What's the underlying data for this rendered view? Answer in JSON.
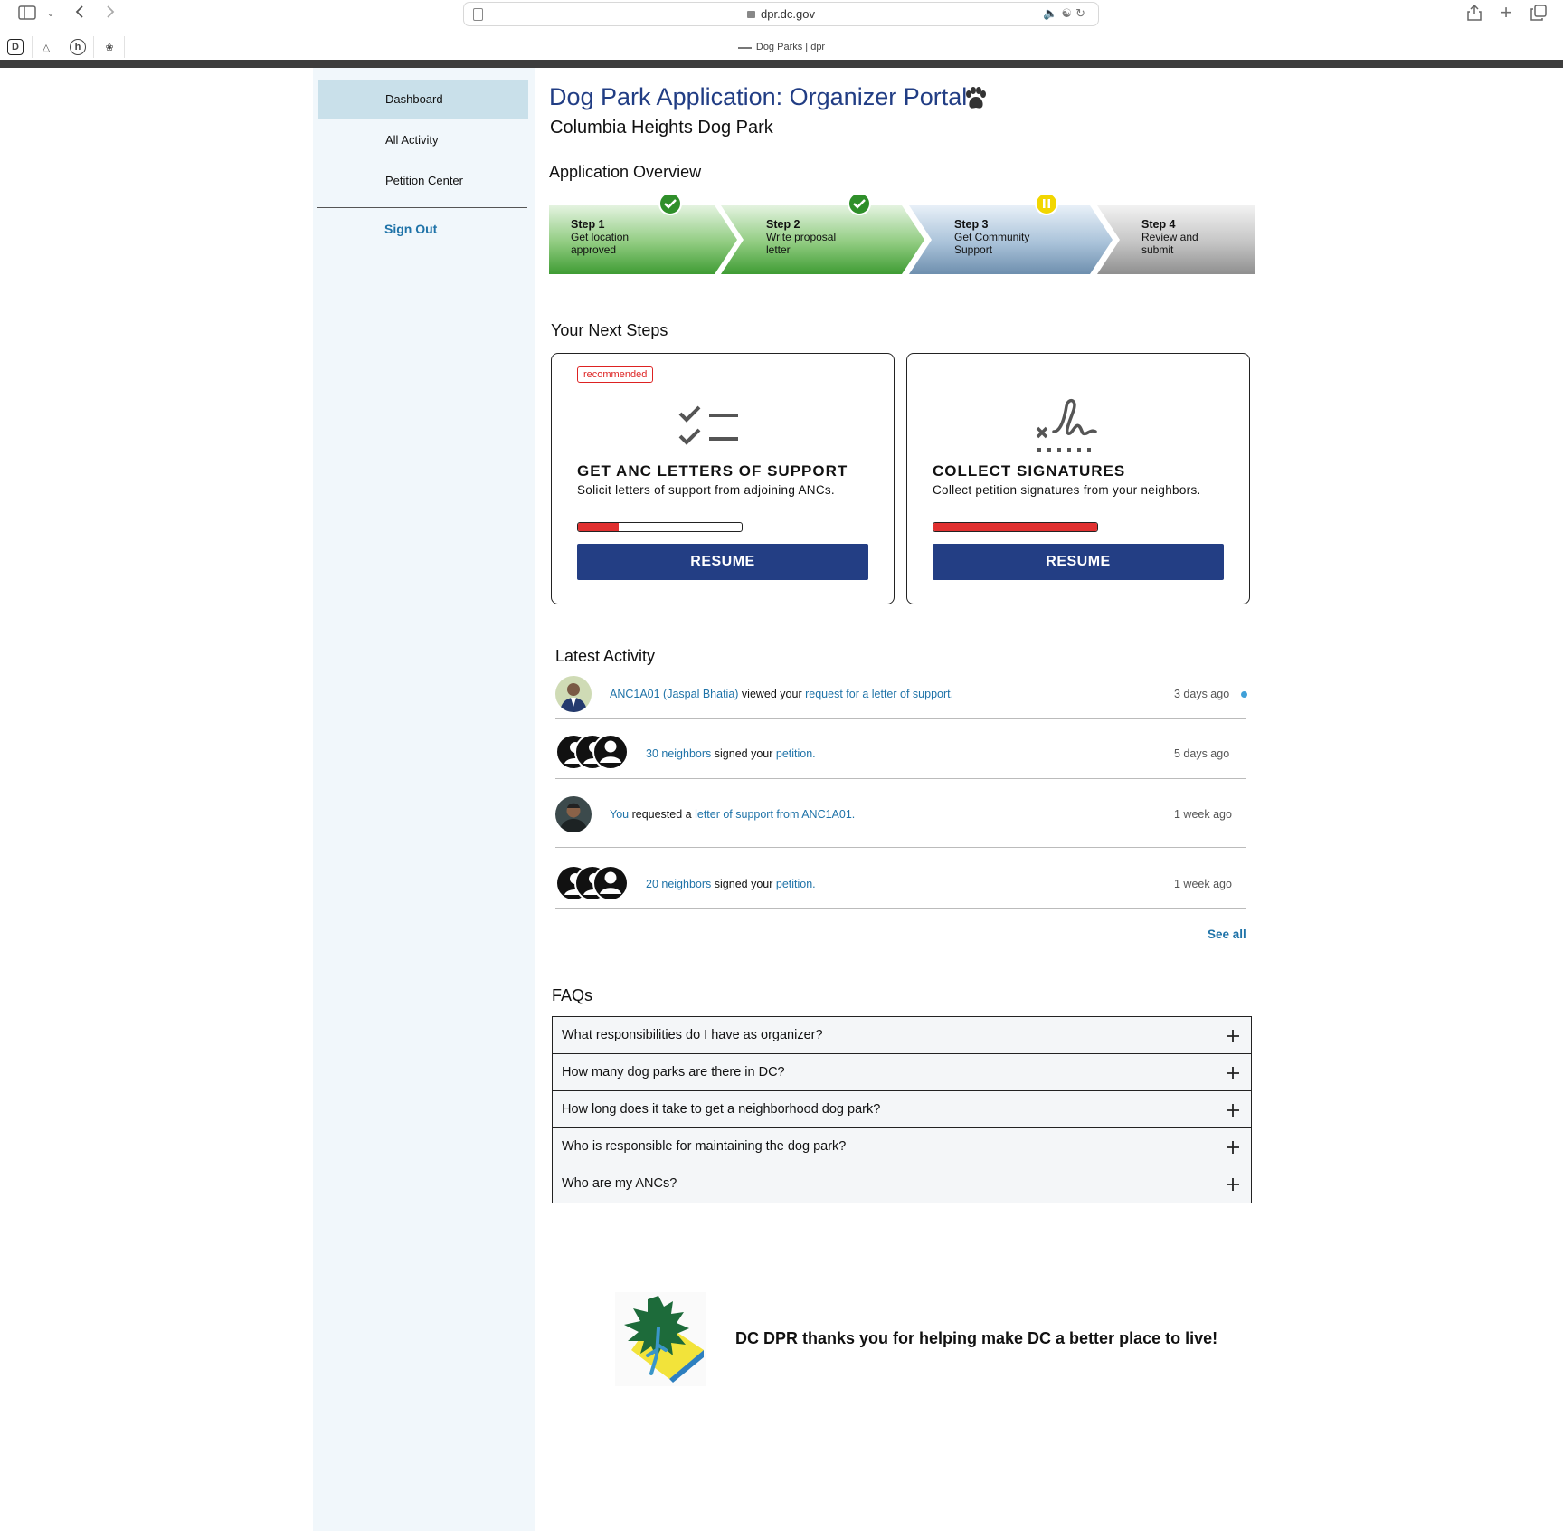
{
  "browser": {
    "url": "dpr.dc.gov",
    "tab_title": "Dog Parks | dpr"
  },
  "sidebar": {
    "items": [
      {
        "label": "Dashboard",
        "active": true
      },
      {
        "label": "All Activity",
        "active": false
      },
      {
        "label": "Petition Center",
        "active": false
      }
    ],
    "sign_out": "Sign Out"
  },
  "header": {
    "title": "Dog Park Application: Organizer Portal",
    "subtitle": "Columbia Heights Dog Park"
  },
  "overview": {
    "heading": "Application Overview",
    "steps": [
      {
        "step": "Step 1",
        "label": "Get location approved",
        "status": "complete"
      },
      {
        "step": "Step 2",
        "label": "Write proposal letter",
        "status": "complete"
      },
      {
        "step": "Step 3",
        "label": "Get Community Support",
        "status": "in-progress"
      },
      {
        "step": "Step 4",
        "label": "Review and submit",
        "status": "not-started"
      }
    ]
  },
  "next_steps": {
    "heading": "Your Next Steps",
    "cards": [
      {
        "badge": "recommended",
        "title": "GET ANC LETTERS OF SUPPORT",
        "description": "Solicit letters of support from adjoining ANCs.",
        "progress": 0.25,
        "button": "RESUME",
        "icon": "checklist-icon"
      },
      {
        "badge": "",
        "title": "COLLECT SIGNATURES",
        "description": "Collect petition signatures from your neighbors.",
        "progress": 1.0,
        "button": "RESUME",
        "icon": "signature-icon"
      }
    ]
  },
  "activity": {
    "heading": "Latest Activity",
    "items": [
      {
        "link1": "ANC1A01 (Jaspal Bhatia)",
        "mid": "viewed your",
        "link2": "request for a letter of support.",
        "time": "3 days ago",
        "unread": true,
        "avatar": "person-photo"
      },
      {
        "link1": "30 neighbors",
        "mid": "signed your",
        "link2": "petition.",
        "time": "5 days ago",
        "unread": false,
        "avatar": "group-icon"
      },
      {
        "link1": "You",
        "mid": "requested a",
        "link2": "letter of support from ANC1A01.",
        "time": "1 week ago",
        "unread": false,
        "avatar": "person-photo"
      },
      {
        "link1": "20 neighbors",
        "mid": "signed your",
        "link2": "petition.",
        "time": "1 week ago",
        "unread": false,
        "avatar": "group-icon"
      }
    ],
    "see_all": "See all"
  },
  "faqs": {
    "heading": "FAQs",
    "items": [
      "What responsibilities do I have as organizer?",
      "How many dog parks are there in DC?",
      "How long does it take to get a neighborhood dog park?",
      "Who is responsible for maintaining the dog park?",
      "Who are my ANCs?"
    ]
  },
  "footer": {
    "text": "DC DPR thanks you for helping make DC a better place to live!"
  },
  "colors": {
    "primary": "#233e84",
    "link": "#1f73a8",
    "sidebar_bg": "#f1f7fb",
    "sidebar_active": "#c9e0ea",
    "progress_red": "#e03030",
    "step_complete": "#4aa547",
    "step_current": "#8aa8c4",
    "step_pending": "#a9a9a9"
  }
}
